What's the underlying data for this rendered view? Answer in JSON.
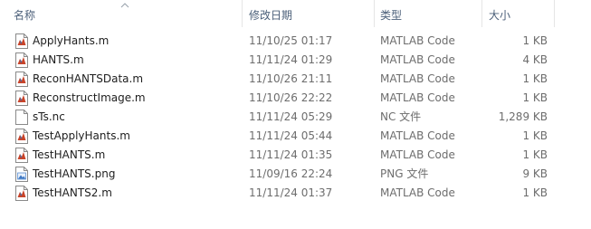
{
  "columns": {
    "name": "名称",
    "date": "修改日期",
    "type": "类型",
    "size": "大小"
  },
  "sort_indicator": "chevron-up-icon",
  "files": [
    {
      "name": "ApplyHants.m",
      "date": "11/10/25 01:17",
      "type": "MATLAB Code",
      "size": "1 KB",
      "icon": "matlab-file-icon"
    },
    {
      "name": "HANTS.m",
      "date": "11/11/24 01:29",
      "type": "MATLAB Code",
      "size": "4 KB",
      "icon": "matlab-file-icon"
    },
    {
      "name": "ReconHANTSData.m",
      "date": "11/10/26 21:11",
      "type": "MATLAB Code",
      "size": "1 KB",
      "icon": "matlab-file-icon"
    },
    {
      "name": "ReconstructImage.m",
      "date": "11/10/26 22:22",
      "type": "MATLAB Code",
      "size": "1 KB",
      "icon": "matlab-file-icon"
    },
    {
      "name": "sTs.nc",
      "date": "11/11/24 05:29",
      "type": "NC 文件",
      "size": "1,289 KB",
      "icon": "blank-file-icon"
    },
    {
      "name": "TestApplyHants.m",
      "date": "11/11/24 05:44",
      "type": "MATLAB Code",
      "size": "1 KB",
      "icon": "matlab-file-icon"
    },
    {
      "name": "TestHANTS.m",
      "date": "11/11/24 01:35",
      "type": "MATLAB Code",
      "size": "1 KB",
      "icon": "matlab-file-icon"
    },
    {
      "name": "TestHANTS.png",
      "date": "11/09/16 22:24",
      "type": "PNG 文件",
      "size": "9 KB",
      "icon": "image-file-icon"
    },
    {
      "name": "TestHANTS2.m",
      "date": "11/11/24 01:37",
      "type": "MATLAB Code",
      "size": "1 KB",
      "icon": "matlab-file-icon"
    }
  ],
  "colors": {
    "header_text": "#4c607a",
    "name_text": "#1e1e1e",
    "detail_text": "#6d6d6d",
    "separator": "#e5e5e5",
    "matlab_icon_red": "#c8442a",
    "matlab_icon_blue": "#2f6fb7"
  }
}
